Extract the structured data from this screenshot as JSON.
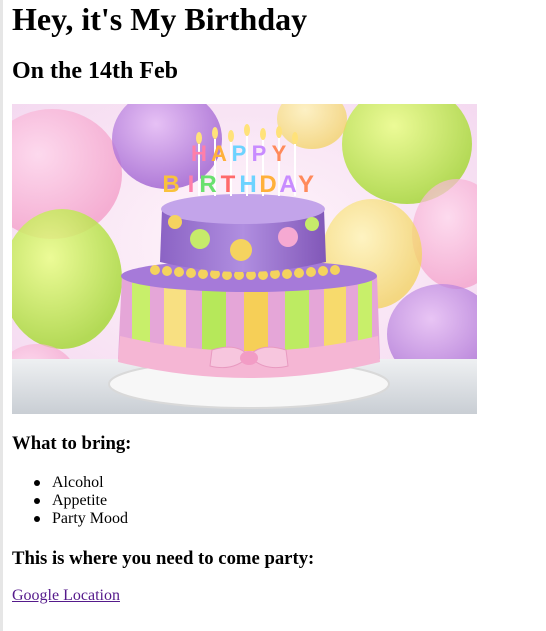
{
  "header": {
    "title": "Hey, it's My Birthday",
    "subtitle": "On the 14th Feb"
  },
  "hero_image": {
    "alt": "Birthday cake",
    "cake_letters": "HAPPY BIRTHDAY",
    "icon": "birthday-cake-photo"
  },
  "bring": {
    "heading": "What to bring:",
    "items": [
      "Alcohol",
      "Appetite",
      "Party Mood"
    ]
  },
  "location": {
    "heading": "This is where you need to come party:",
    "link_label": "Google Location"
  },
  "colors": {
    "link_visited": "#551a8b",
    "text": "#000000",
    "background": "#ffffff"
  }
}
